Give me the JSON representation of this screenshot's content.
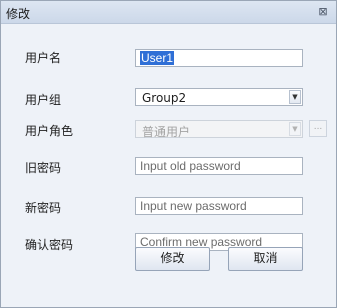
{
  "window": {
    "title": "修改",
    "close_glyph": "⊠"
  },
  "form": {
    "username": {
      "label": "用户名",
      "value": "User1"
    },
    "usergroup": {
      "label": "用户组",
      "selected": "Group2"
    },
    "userrole": {
      "label": "用户角色",
      "selected": "普通用户",
      "more_button": "..."
    },
    "old_password": {
      "label": "旧密码",
      "placeholder": "Input old password"
    },
    "new_password": {
      "label": "新密码",
      "placeholder": "Input new password"
    },
    "confirm_password": {
      "label": "确认密码",
      "placeholder": "Confirm new password"
    }
  },
  "buttons": {
    "modify": "修改",
    "cancel": "取消"
  }
}
